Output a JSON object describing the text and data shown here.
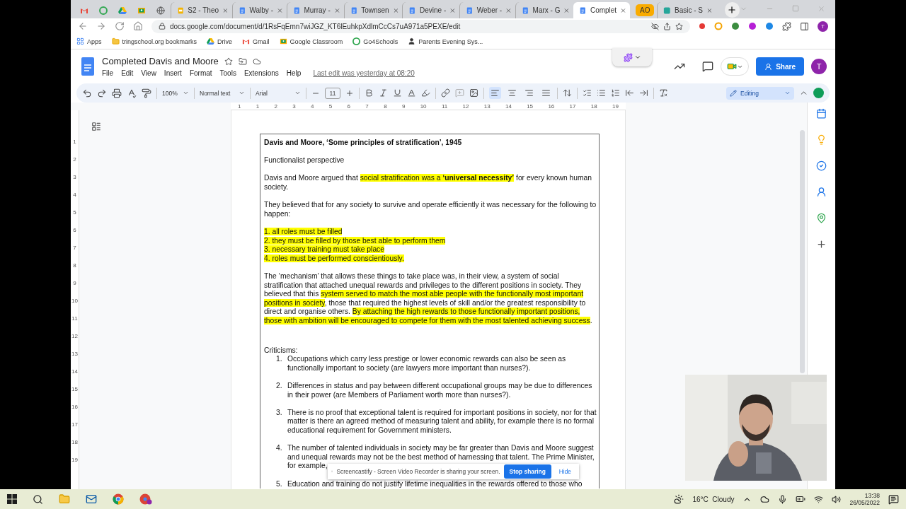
{
  "browser": {
    "tabs": [
      {
        "kind": "gmail",
        "selected": false
      },
      {
        "kind": "go4",
        "selected": false
      },
      {
        "kind": "drive",
        "selected": false
      },
      {
        "kind": "classroom",
        "selected": false
      },
      {
        "kind": "globe",
        "selected": false
      },
      {
        "kind": "slides",
        "title": "S2 - Theo",
        "selected": false
      },
      {
        "kind": "docs",
        "title": "Walby -",
        "selected": false
      },
      {
        "kind": "docs",
        "title": "Murray -",
        "selected": false
      },
      {
        "kind": "docs",
        "title": "Townsen",
        "selected": false
      },
      {
        "kind": "docs",
        "title": "Devine -",
        "selected": false
      },
      {
        "kind": "docs",
        "title": "Weber -",
        "selected": false
      },
      {
        "kind": "docs",
        "title": "Marx - G",
        "selected": false
      },
      {
        "kind": "docs",
        "title": "Complet",
        "selected": true
      }
    ],
    "tab_group": "AO",
    "group_tabs": [
      {
        "kind": "app",
        "title": "Basic - S",
        "selected": false
      }
    ],
    "url": "docs.google.com/document/d/1RsFqEmn7wiJGZ_KT6lEuhkpXdlmCcCs7uA971a5PEXE/edit",
    "profile_initial": "T",
    "bookmarks": [
      {
        "kind": "apps",
        "label": "Apps"
      },
      {
        "kind": "folder",
        "label": "tringschool.org bookmarks"
      },
      {
        "kind": "drive",
        "label": "Drive"
      },
      {
        "kind": "gmail",
        "label": "Gmail"
      },
      {
        "kind": "classroom",
        "label": "Google Classroom"
      },
      {
        "kind": "go4",
        "label": "Go4Schools"
      },
      {
        "kind": "person",
        "label": "Parents Evening Sys..."
      }
    ]
  },
  "docs": {
    "title": "Completed Davis and Moore",
    "menus": [
      "File",
      "Edit",
      "View",
      "Insert",
      "Format",
      "Tools",
      "Extensions",
      "Help"
    ],
    "last_edit": "Last edit was yesterday at 08:20",
    "share": "Share",
    "avatar": "T",
    "zoom": "100%",
    "style": "Normal text",
    "font": "Arial",
    "font_size": "11",
    "mode": "Editing",
    "alignment": [
      {
        "kind": "left",
        "selected": true
      },
      {
        "kind": "center",
        "selected": false
      },
      {
        "kind": "right",
        "selected": false
      },
      {
        "kind": "justify",
        "selected": false
      }
    ],
    "ruler_marks": [
      "1",
      "1",
      "2",
      "3",
      "4",
      "5",
      "6",
      "7",
      "8",
      "9",
      "10",
      "11",
      "12",
      "13",
      "14",
      "15",
      "16",
      "17",
      "18",
      "19"
    ],
    "vertical_ruler_marks": [
      "1",
      "2",
      "3",
      "4",
      "5",
      "6",
      "7",
      "8",
      "9",
      "10",
      "11",
      "12",
      "13",
      "14",
      "15",
      "16",
      "17",
      "18",
      "19"
    ]
  },
  "document": {
    "heading": "Davis and Moore, ‘Some principles of stratification’, 1945",
    "paragraphs": [
      {
        "parts": [
          {
            "text": "Functionalist perspective",
            "highlighted": false
          }
        ]
      },
      {
        "parts": [
          {
            "text": "Davis and Moore argued that ",
            "highlighted": false
          },
          {
            "text": "social stratification was a **‘universal necessity’**",
            "highlighted": true
          },
          {
            "text": " for every known human society.",
            "highlighted": false
          }
        ]
      },
      {
        "parts": [
          {
            "text": "They believed that for any society to survive and operate efficiently it was necessary for the following to happen:",
            "highlighted": false
          }
        ]
      }
    ],
    "requirements": [
      {
        "text": "1. all roles must be filled",
        "highlighted": true
      },
      {
        "text": "2. they must be filled by those best able to perform them",
        "highlighted": true
      },
      {
        "text": "3. necessary training must take place",
        "highlighted": true
      },
      {
        "text": "4. roles must be performed conscientiously.",
        "highlighted": true
      }
    ],
    "mechanism": {
      "parts": [
        {
          "text": "The ‘mechanism’ that allows these things to take place was, in their view, a system of social stratification that attached unequal rewards and privileges to the different positions in society. They believed that this ",
          "highlighted": false
        },
        {
          "text": "system served to match the most able people with the functionally most important positions in society",
          "highlighted": true
        },
        {
          "text": ", those that required the highest levels of skill and/or the greatest responsibility to direct and organise others. ",
          "highlighted": false
        },
        {
          "text": "By attaching the high rewards to those functionally important positions, those with ambition will be encouraged to compete for them with the most talented achieving success",
          "highlighted": true
        },
        {
          "text": ".",
          "highlighted": false
        }
      ]
    },
    "criticisms_label": "Criticisms:",
    "criticisms": [
      {
        "number": "1.",
        "text": "Occupations which carry less prestige or lower economic rewards can also be seen as functionally important to society (are lawyers more important than nurses?)."
      },
      {
        "number": "2.",
        "text": "Differences in status and pay between different occupational groups may be due to differences in their power (are Members of Parliament worth more than nurses?)."
      },
      {
        "number": "3.",
        "text": "There is no proof that exceptional talent is required for important positions in society, nor for that matter is there an agreed method of measuring talent and ability, for example there is no formal educational requirement for Government ministers."
      },
      {
        "number": "4.",
        "text": "The number of talented individuals in society may be far greater than Davis and Moore suggest and unequal rewards may not be the best method of harnessing that talent. The Prime Minister, for example,"
      },
      {
        "number": "5.",
        "text": "Education and training do not justify lifetime inequalities in the rewards offered to those who"
      }
    ]
  },
  "sharing_bar": {
    "message": "Screencastify - Screen Video Recorder is sharing your screen.",
    "stop": "Stop sharing",
    "hide": "Hide"
  },
  "taskbar": {
    "weather": "16°C  Cloudy",
    "time": "13:38",
    "date": "26/05/2022"
  }
}
